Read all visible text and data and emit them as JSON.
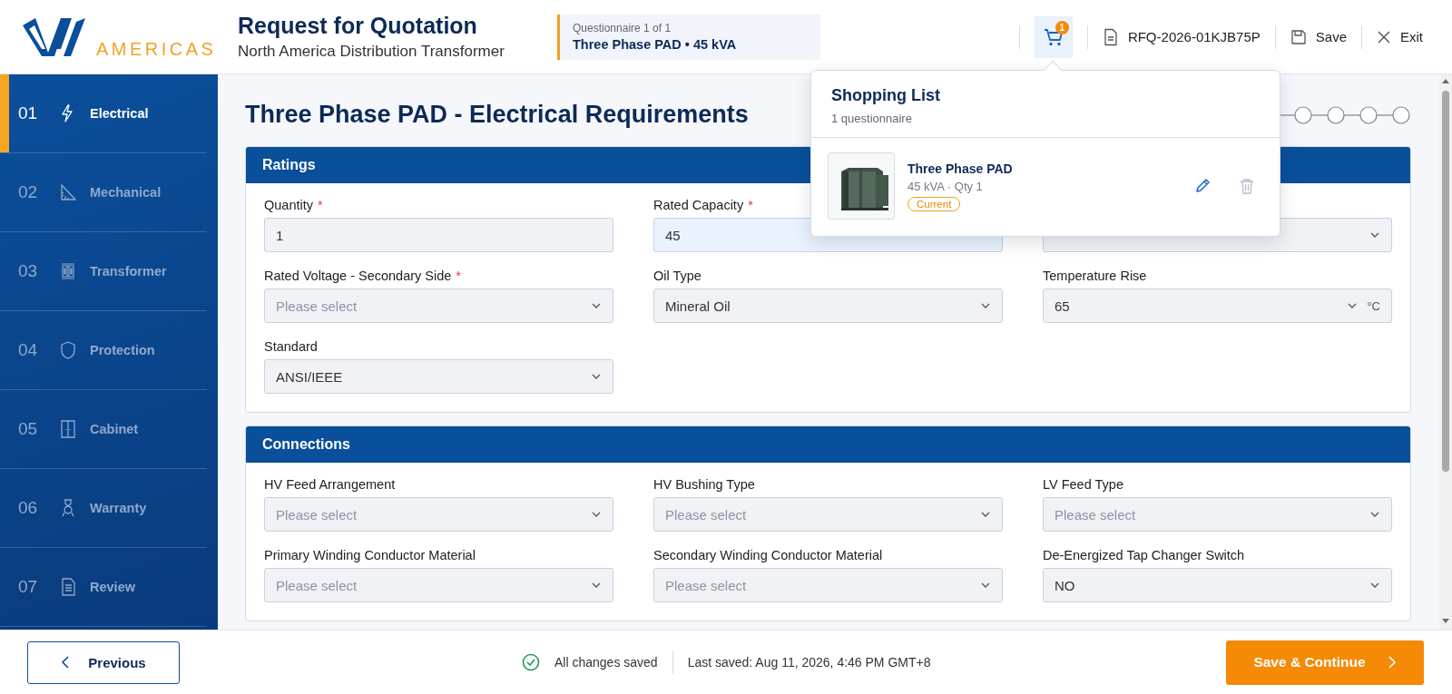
{
  "header": {
    "logo_text": "AMERICAS",
    "title": "Request for Quotation",
    "subtitle": "North America Distribution Transformer",
    "questionnaire": {
      "label": "Questionnaire 1 of 1",
      "name": "Three Phase PAD • 45 kVA"
    },
    "cart_count": "1",
    "rfq_number": "RFQ-2026-01KJB75P",
    "save_label": "Save",
    "exit_label": "Exit"
  },
  "sidebar": {
    "items": [
      {
        "number": "01",
        "label": "Electrical",
        "selected": true
      },
      {
        "number": "02",
        "label": "Mechanical",
        "selected": false
      },
      {
        "number": "03",
        "label": "Transformer",
        "selected": false
      },
      {
        "number": "04",
        "label": "Protection",
        "selected": false
      },
      {
        "number": "05",
        "label": "Cabinet",
        "selected": false
      },
      {
        "number": "06",
        "label": "Warranty",
        "selected": false
      },
      {
        "number": "07",
        "label": "Review",
        "selected": false
      }
    ]
  },
  "page_title": "Three Phase PAD - Electrical Requirements",
  "sections": [
    {
      "title": "Ratings",
      "fields": [
        {
          "kind": "input",
          "label": "Quantity",
          "required_mark": "*",
          "value": "1",
          "highlighted": false
        },
        {
          "kind": "input",
          "label": "Rated Capacity",
          "required_mark": "*",
          "value": "45",
          "highlighted": true
        },
        {
          "kind": "select"
        },
        {
          "kind": "select",
          "label": "Rated Voltage - Secondary Side",
          "required_mark": "*",
          "placeholder": "Please select"
        },
        {
          "kind": "select",
          "label": "Oil Type",
          "value": "Mineral Oil"
        },
        {
          "kind": "select",
          "label": "Temperature Rise",
          "value": "65",
          "unit": "°C"
        },
        {
          "kind": "select",
          "label": "Standard",
          "value": "ANSI/IEEE"
        }
      ]
    },
    {
      "title": "Connections",
      "fields": [
        {
          "kind": "select",
          "label": "HV Feed Arrangement",
          "placeholder": "Please select"
        },
        {
          "kind": "select",
          "label": "HV Bushing Type",
          "placeholder": "Please select"
        },
        {
          "kind": "select",
          "label": "LV Feed Type",
          "placeholder": "Please select"
        },
        {
          "kind": "select",
          "label": "Primary Winding Conductor Material",
          "placeholder": "Please select"
        },
        {
          "kind": "select",
          "label": "Secondary Winding Conductor Material",
          "placeholder": "Please select"
        },
        {
          "kind": "select",
          "label": "De-Energized Tap Changer Switch",
          "value": "NO"
        }
      ]
    }
  ],
  "shopping_list": {
    "title": "Shopping List",
    "subtitle": "1 questionnaire",
    "items": [
      {
        "kind": "picture",
        "name": "Three Phase PAD",
        "detail": "45 kVA · Qty 1",
        "badge": "Current"
      }
    ]
  },
  "footer": {
    "previous": "Previous",
    "status": "All changes saved",
    "last_saved": "Last saved: Aug 11, 2026, 4:46 PM GMT+8",
    "continue": "Save & Continue"
  }
}
